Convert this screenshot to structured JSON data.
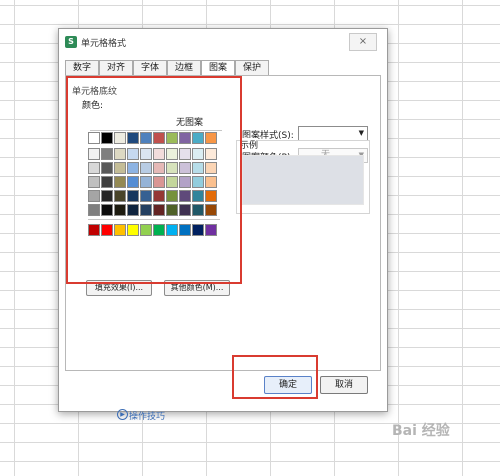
{
  "dialog": {
    "title": "单元格格式",
    "app_icon_text": "S",
    "close_icon": "×"
  },
  "tabs": [
    {
      "label": "数字"
    },
    {
      "label": "对齐"
    },
    {
      "label": "字体"
    },
    {
      "label": "边框"
    },
    {
      "label": "图案"
    },
    {
      "label": "保护"
    }
  ],
  "shading": {
    "section_title": "单元格底纹",
    "color_label": "颜色:",
    "no_pattern": "无图案",
    "fill_effects_button": "填充效果(I)...",
    "more_colors_button": "其他颜色(M)..."
  },
  "palette": {
    "row1": [
      "#ffffff",
      "#000000",
      "#eeece1",
      "#1f497d",
      "#4f81bd",
      "#c0504d",
      "#9bbb59",
      "#8064a2",
      "#4bacc6",
      "#f79646"
    ],
    "row2": [
      "#f2f2f2",
      "#7f7f7f",
      "#ddd9c3",
      "#c6d9f0",
      "#dbe5f1",
      "#f2dcdb",
      "#ebf1dd",
      "#e5e0ec",
      "#dbeef3",
      "#fdeada"
    ],
    "row3": [
      "#d8d8d8",
      "#595959",
      "#c4bd97",
      "#8db3e2",
      "#b8cce4",
      "#e5b9b7",
      "#d7e3bc",
      "#ccc1d9",
      "#b7dde8",
      "#fbd5b5"
    ],
    "row4": [
      "#bfbfbf",
      "#3f3f3f",
      "#938953",
      "#548dd4",
      "#95b3d7",
      "#d99694",
      "#c3d69b",
      "#b2a2c7",
      "#92cddc",
      "#fac08f"
    ],
    "row5": [
      "#a5a5a5",
      "#262626",
      "#494429",
      "#17365d",
      "#366092",
      "#953734",
      "#76923c",
      "#5f497a",
      "#31859b",
      "#e36c09"
    ],
    "row6": [
      "#7f7f7f",
      "#0c0c0c",
      "#1d1b10",
      "#0f243e",
      "#244061",
      "#632423",
      "#4f6128",
      "#3f3151",
      "#205867",
      "#974806"
    ],
    "standard": [
      "#c00000",
      "#ff0000",
      "#ffc000",
      "#ffff00",
      "#92d050",
      "#00b050",
      "#00b0f0",
      "#0070c0",
      "#002060",
      "#7030a0"
    ]
  },
  "pattern": {
    "style_label": "图案样式(S):",
    "style_value": "",
    "color_label": "图案颜色(P):",
    "color_value": "无",
    "sample_title": "示例"
  },
  "footer": {
    "tips_label": "操作技巧",
    "ok_button": "确定",
    "cancel_button": "取消"
  },
  "watermark": "Bai 经验"
}
